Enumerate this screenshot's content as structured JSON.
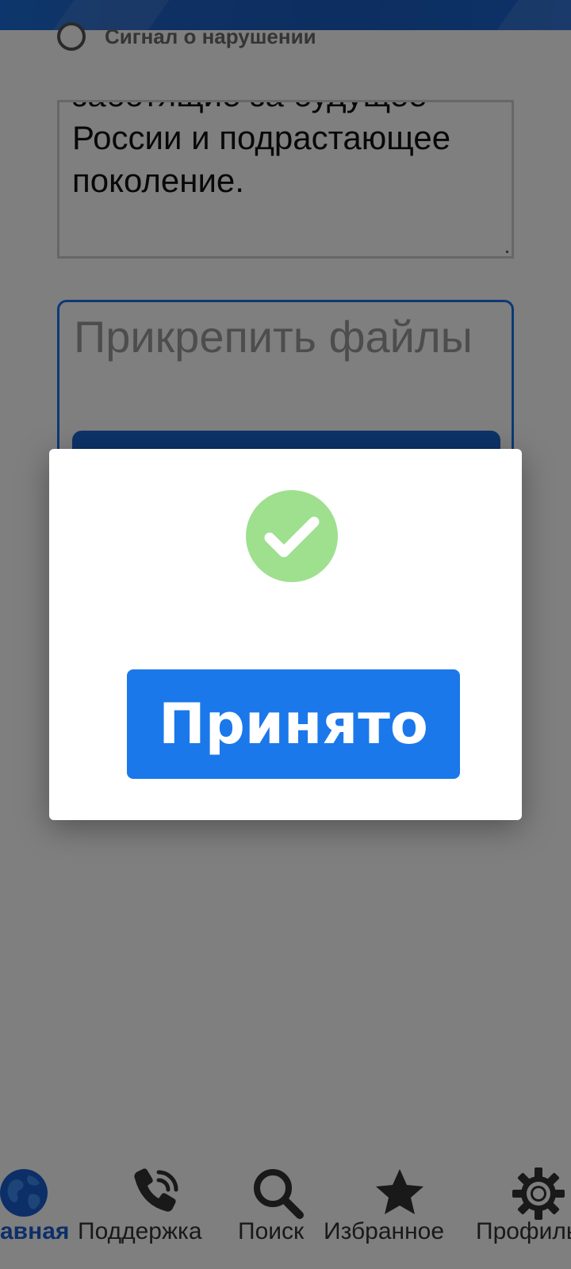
{
  "form": {
    "radio_label": "Сигнал о нарушении",
    "textarea_value": "заботящие за будущее России и подрастающее поколение.",
    "attach_title": "Прикрепить файлы"
  },
  "bottom_nav": {
    "items": [
      {
        "label": "Главная",
        "icon": "globe-icon",
        "active": true
      },
      {
        "label": "Поддержка",
        "icon": "phone-icon",
        "active": false
      },
      {
        "label": "Поиск",
        "icon": "search-icon",
        "active": false
      },
      {
        "label": "Избранное",
        "icon": "star-icon",
        "active": false
      },
      {
        "label": "Профиль",
        "icon": "gear-icon",
        "active": false
      }
    ]
  },
  "modal": {
    "icon": "check-circle-icon",
    "accept_label": "Принято"
  },
  "colors": {
    "header_blue": "#1b66d1",
    "accent_blue": "#1b78ea",
    "success_green": "#9ee08e",
    "overlay": "rgba(0,0,0,0.5)"
  }
}
